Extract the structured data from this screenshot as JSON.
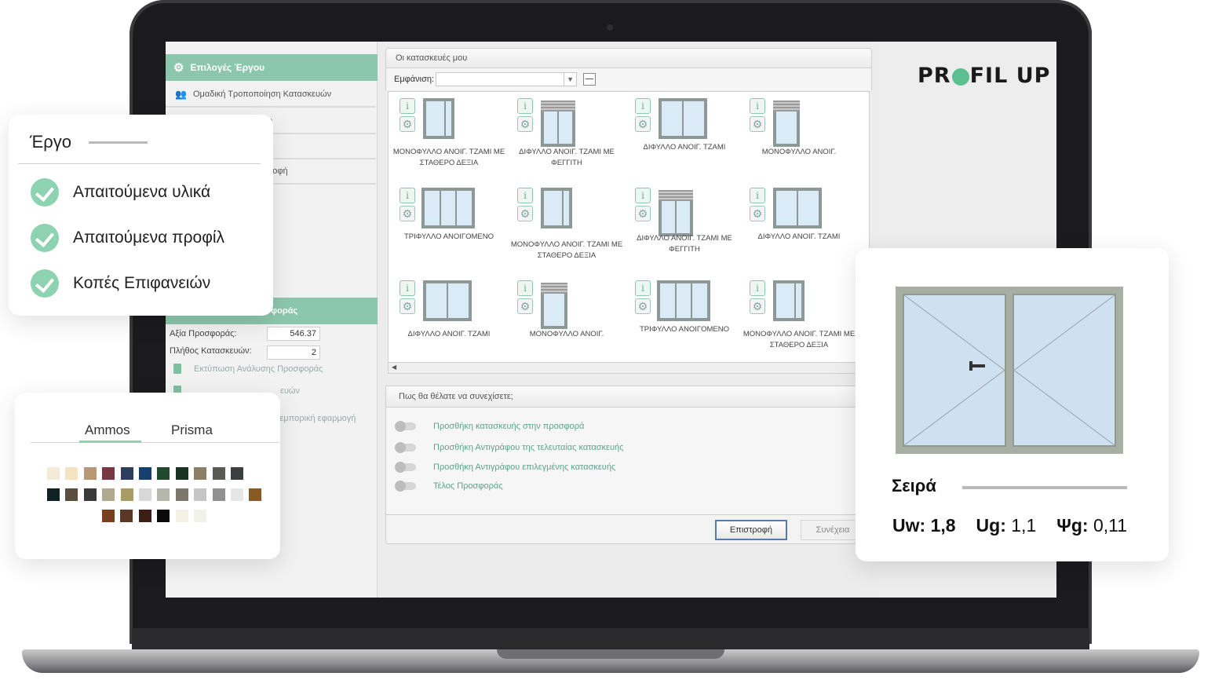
{
  "app": {
    "logo_text_left": "PR",
    "logo_text_right": "FIL UP",
    "accent_color": "#8cc7ad"
  },
  "left_pane": {
    "header": "Επιλογές Έργου",
    "group_edit": "Ομαδική Τροποποίηση Κατασκευών",
    "partial_items": [
      "ο",
      "ροφή"
    ],
    "offer_header": "οσφοράς",
    "offer_value_label": "Αξία Προσφοράς:",
    "offer_value": "546.37",
    "constructions_count_label": "Πλήθος Κατασκευών:",
    "constructions_count": "2",
    "print_analysis": "Εκτύπωση Ανάλυσης Προσφοράς",
    "partial_link_2": "ευών",
    "partial_link_3": "ι εμπορική εφαρμογή"
  },
  "center": {
    "my_constructions_title": "Οι κατασκευές μου",
    "display_label": "Εμφάνιση:",
    "display_value": "",
    "gallery": [
      {
        "label": "ΜΟΝΟΦΥΛΛΟ ΑΝΟΙΓ. ΤΖΑΜΙ ΜΕ ΣΤΑΘΕΡΟ ΔΕΞΙΑ"
      },
      {
        "label": "ΔΙΦΥΛΛΟ ΑΝΟΙΓ. ΤΖΑΜΙ ΜΕ ΦΕΓΓΙΤΗ"
      },
      {
        "label": "ΔΙΦΥΛΛΟ ΑΝΟΙΓ. ΤΖΑΜΙ"
      },
      {
        "label": "ΜΟΝΟΦΥΛΛΟ ΑΝΟΙΓ."
      },
      {
        "label": "ΤΡΙΦΥΛΛΟ ΑΝΟΙΓΟΜΕΝΟ"
      },
      {
        "label": "ΜΟΝΟΦΥΛΛΟ ΑΝΟΙΓ. ΤΖΑΜΙ ΜΕ ΣΤΑΘΕΡΟ ΔΕΞΙΑ"
      },
      {
        "label": "ΔΙΦΥΛΛΟ ΑΝΟΙΓ. ΤΖΑΜΙ ΜΕ ΦΕΓΓΙΤΗ"
      },
      {
        "label": "ΔΙΦΥΛΛΟ ΑΝΟΙΓ. ΤΖΑΜΙ"
      },
      {
        "label": "ΔΙΦΥΛΛΟ ΑΝΟΙΓ. ΤΖΑΜΙ"
      },
      {
        "label": "ΜΟΝΟΦΥΛΛΟ ΑΝΟΙΓ."
      },
      {
        "label": "ΤΡΙΦΥΛΛΟ ΑΝΟΙΓΟΜΕΝΟ"
      },
      {
        "label": "ΜΟΝΟΦΥΛΛΟ ΑΝΟΙΓ. ΤΖΑΜΙ ΜΕ ΣΤΑΘΕΡΟ ΔΕΞΙΑ"
      }
    ],
    "continue_question": "Πως θα θέλατε να συνεχίσετε;",
    "options": [
      "Προσθήκη κατασκευής στην προσφορά",
      "Προσθήκη Αντιγράφου της τελευταίας κατασκευής",
      "Προσθήκη Αντιγράφου επιλεγμένης κατασκευής",
      "Τέλος Προσφοράς"
    ],
    "back_button": "Επιστροφή",
    "next_button": "Συνέχεια"
  },
  "ergo_card": {
    "title": "Έργο",
    "items": [
      "Απαιτούμενα  υλικά",
      "Απαιτούμενα  προφίλ",
      "Κοπές Επιφανειών"
    ]
  },
  "colors_card": {
    "tabs": [
      "Ammos",
      "Prisma"
    ],
    "active_tab": "Ammos",
    "swatches_row1": [
      "#f4ead9",
      "#f3e3c2",
      "#b79a75",
      "#7a3642",
      "#2d3e5c",
      "#163f71",
      "#1f4a2e",
      "#163324",
      "#8b7f68",
      "#5a5a55",
      "#3c3f40"
    ],
    "swatches_row2": [
      "#0f2324",
      "#5a4f3f",
      "#3b3a38",
      "#b2a88f",
      "#a89b63",
      "#d8d8d8",
      "#b6b6ad",
      "#7c776a",
      "#c5c5c5",
      "#909090",
      "#e6e6e6",
      "#8a5a26"
    ],
    "swatches_row3": [
      "#7a3d1e",
      "#5b3724",
      "#3d1e17",
      "#0a0a0a",
      "#f4f0e4",
      "#f1f1ea"
    ]
  },
  "series_card": {
    "title": "Σειρά",
    "uw_label": "Uw:",
    "uw_value": "1,8",
    "ug_label": "Ug:",
    "ug_value": "1,1",
    "psig_label": "Ψg:",
    "psig_value": "0,11"
  }
}
